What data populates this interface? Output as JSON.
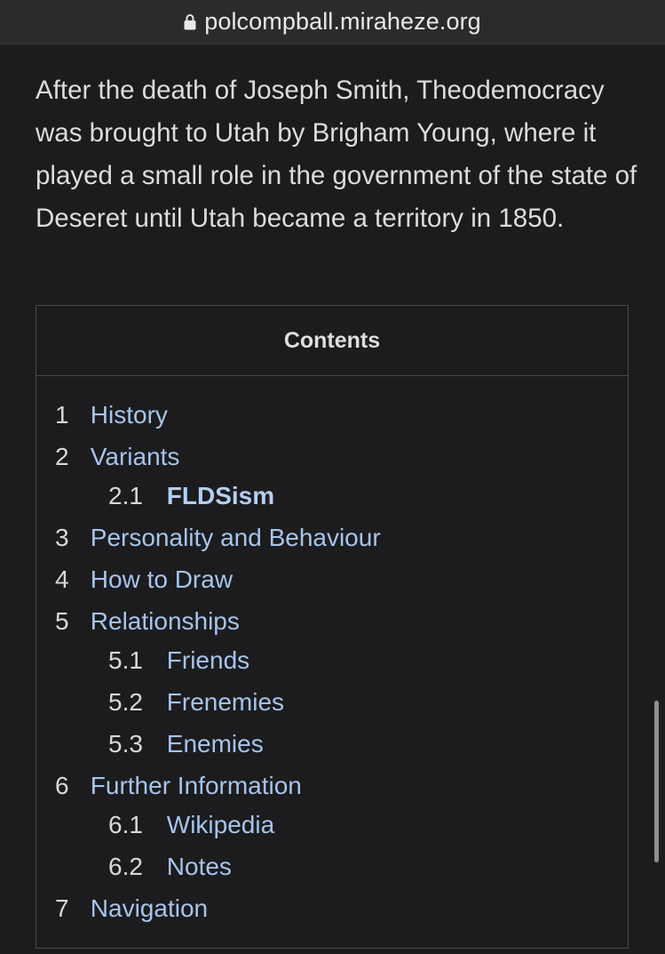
{
  "browser": {
    "url": "polcompball.miraheze.org",
    "lock_icon": "lock-icon"
  },
  "article": {
    "paragraph": "After the death of Joseph Smith, Theodemocracy was brought to Utah by Brigham Young, where it played a small role in the government of the state of Deseret until Utah became a territory in 1850."
  },
  "toc": {
    "title": "Contents",
    "items": [
      {
        "num": "1",
        "label": "History",
        "level": 1,
        "bold": false
      },
      {
        "num": "2",
        "label": "Variants",
        "level": 1,
        "bold": false
      },
      {
        "num": "2.1",
        "label": "FLDSism",
        "level": 2,
        "bold": true
      },
      {
        "num": "3",
        "label": "Personality and Behaviour",
        "level": 1,
        "bold": false
      },
      {
        "num": "4",
        "label": "How to Draw",
        "level": 1,
        "bold": false
      },
      {
        "num": "5",
        "label": "Relationships",
        "level": 1,
        "bold": false
      },
      {
        "num": "5.1",
        "label": "Friends",
        "level": 2,
        "bold": false
      },
      {
        "num": "5.2",
        "label": "Frenemies",
        "level": 2,
        "bold": false
      },
      {
        "num": "5.3",
        "label": "Enemies",
        "level": 2,
        "bold": false
      },
      {
        "num": "6",
        "label": "Further Information",
        "level": 1,
        "bold": false
      },
      {
        "num": "6.1",
        "label": "Wikipedia",
        "level": 2,
        "bold": false
      },
      {
        "num": "6.2",
        "label": "Notes",
        "level": 2,
        "bold": false
      },
      {
        "num": "7",
        "label": "Navigation",
        "level": 1,
        "bold": false
      }
    ]
  },
  "colors": {
    "background": "#1c1c1e",
    "link": "#a6c4ec",
    "text": "#dcdcdc",
    "border": "#4a4a4c"
  }
}
